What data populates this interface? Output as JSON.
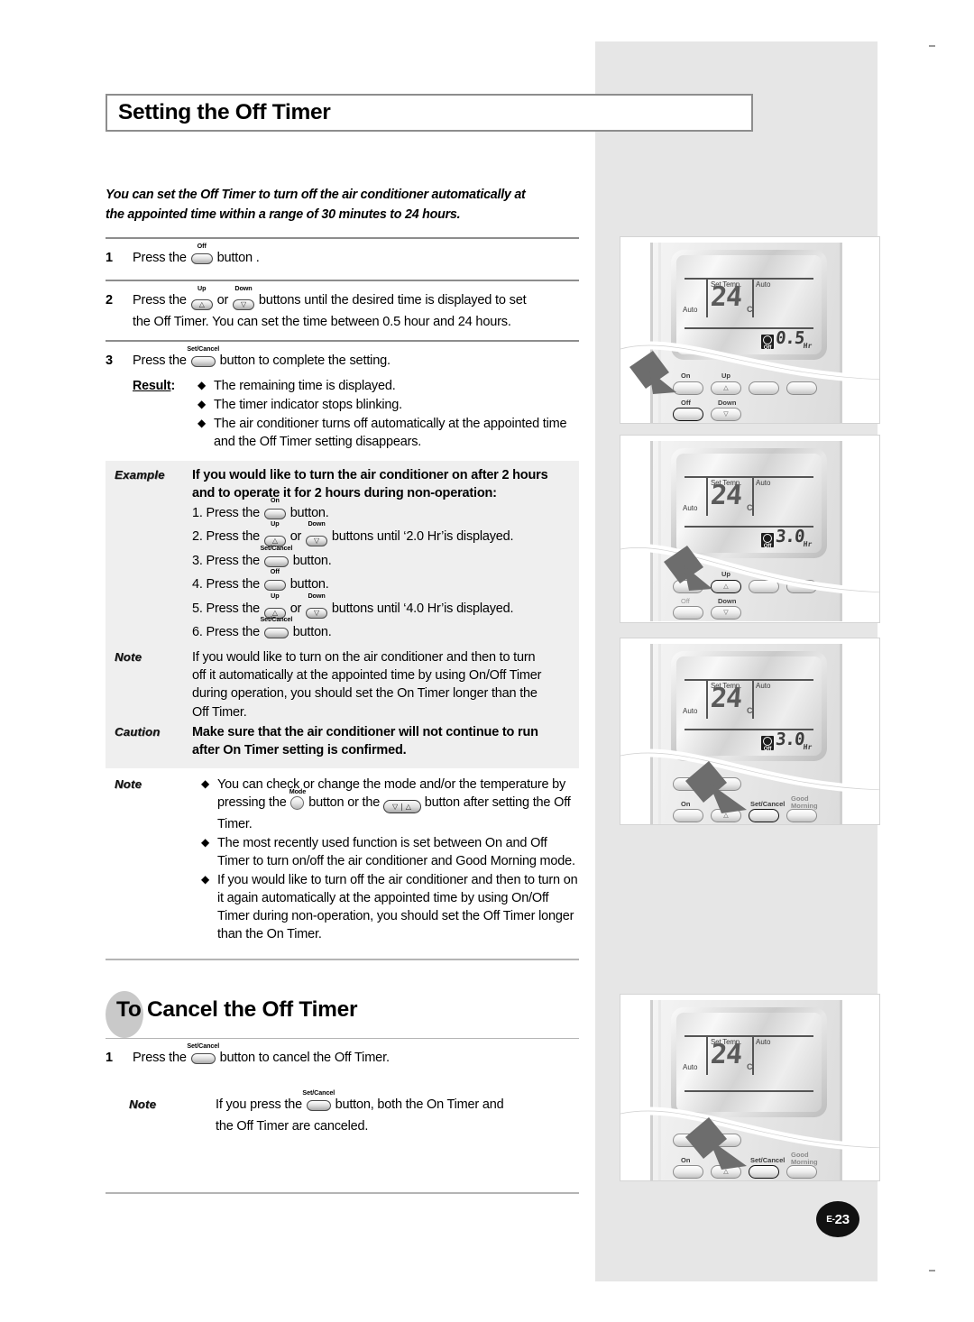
{
  "page": {
    "title": "Setting the Off Timer",
    "page_number": "E-23",
    "page_number_prefix": "E-",
    "page_number_value": "23"
  },
  "intro": {
    "line1": "You can set the Off Timer to turn off the air conditioner automatically at",
    "line2": "the appointed time within a range of 30 minutes to 24 hours."
  },
  "steps": [
    {
      "num": "1",
      "pre": "Press the",
      "button": "Off",
      "post": "button ."
    },
    {
      "num": "2",
      "pre": "Press the",
      "button_a": "Up",
      "mid": "or",
      "button_b": "Down",
      "post_line1": "buttons until the desired time is displayed to set",
      "post_line2": "the Off Timer. You can set the time between 0.5 hour and 24 hours."
    },
    {
      "num": "3",
      "pre": "Press the",
      "button": "Set/Cancel",
      "post": "button to complete the setting."
    }
  ],
  "result": {
    "label": "Result",
    "colon": ":",
    "bullets": [
      "The remaining time is displayed.",
      "The timer indicator stops blinking.",
      "The air conditioner turns off automatically at the appointed time and the Off Timer setting disappears."
    ]
  },
  "example": {
    "tag": "Example",
    "headline_line1": "If you would like to turn the air conditioner on after 2 hours",
    "headline_line2": "and to operate it for 2 hours during non-operation:",
    "lines": [
      {
        "num": "1.",
        "pre": "Press the",
        "button": "On",
        "post": "button."
      },
      {
        "num": "2.",
        "pre": "Press the",
        "button_a": "Up",
        "mid": "or",
        "button_b": "Down",
        "post": "buttons until ‘2.0 Hr’is displayed."
      },
      {
        "num": "3.",
        "pre": "Press the",
        "button": "Set/Cancel",
        "post": "button."
      },
      {
        "num": "4.",
        "pre": "Press the",
        "button": "Off",
        "post": "button."
      },
      {
        "num": "5.",
        "pre": "Press the",
        "button_a": "Up",
        "mid": "or",
        "button_b": "Down",
        "post": "buttons until ‘4.0 Hr’is displayed."
      },
      {
        "num": "6.",
        "pre": "Press the",
        "button": "Set/Cancel",
        "post": "button."
      }
    ]
  },
  "note_shaded": {
    "tag": "Note",
    "line1": "If you would like to turn on the air conditioner and then to turn",
    "line2": "off it automatically at the appointed time by using On/Off Timer",
    "line3": "during operation, you should set the On Timer longer than the",
    "line4": "Off Timer."
  },
  "caution": {
    "tag": "Caution",
    "line1": "Make sure that the air conditioner will not continue to run",
    "line2": "after On Timer setting is confirmed."
  },
  "note_bullets": {
    "tag": "Note",
    "items": [
      {
        "pre": "You can check or change the mode and/or the temperature by pressing the",
        "button_mode": "Mode",
        "mid": "button or the",
        "button_temp": "temperature-adjust",
        "post": "button after setting the Off Timer."
      },
      {
        "text": "The most recently used function is set between On and Off Timer to turn on/off the air conditioner and Good Morning mode."
      },
      {
        "text": "If you would like to turn off the air conditioner and then to turn on it again automatically at the appointed time by using On/Off Timer during non-operation, you should set the Off Timer longer than the On Timer."
      }
    ]
  },
  "cancel_section": {
    "heading_first_word": "To",
    "heading_rest": "Cancel the Off Timer",
    "step": {
      "num": "1",
      "pre": "Press the",
      "button": "Set/Cancel",
      "post": "button to cancel the Off Timer."
    },
    "note": {
      "tag": "Note",
      "pre": "If you press the",
      "button": "Set/Cancel",
      "post_line1": "button, both the On Timer and",
      "post_line2": "the Off Timer are canceled."
    }
  },
  "illustrations": [
    {
      "caption_id": "off-button-press",
      "lcd": {
        "set_temp_label": "Set Temp.",
        "auto_top": "Auto",
        "auto_left": "Auto",
        "temperature": "24",
        "unit": "C",
        "timer_indicator": "Off",
        "timer_value": "0.5",
        "timer_unit": "Hr"
      },
      "keys": [
        "On",
        "Up",
        "Off",
        "Down"
      ],
      "highlight_key": "Off"
    },
    {
      "caption_id": "up-button-press",
      "lcd": {
        "set_temp_label": "Set Temp.",
        "auto_top": "Auto",
        "auto_left": "Auto",
        "temperature": "24",
        "unit": "C",
        "timer_indicator": "Off",
        "timer_value": "3.0",
        "timer_unit": "Hr"
      },
      "keys": [
        "Off",
        "Up",
        "Off",
        "Down"
      ],
      "highlight_key": "Up"
    },
    {
      "caption_id": "set-cancel-button-press",
      "lcd": {
        "set_temp_label": "Set Temp.",
        "auto_top": "Auto",
        "auto_left": "Auto",
        "temperature": "24",
        "unit": "C",
        "timer_indicator": "Off",
        "timer_value": "3.0",
        "timer_unit": "Hr"
      },
      "keys": [
        "On",
        "Set/Cancel",
        "Good Morning"
      ],
      "highlight_key": "Set/Cancel"
    },
    {
      "caption_id": "cancel-off-timer",
      "lcd": {
        "set_temp_label": "Set Temp.",
        "auto_top": "Auto",
        "auto_left": "Auto",
        "temperature": "24",
        "unit": "C",
        "timer_indicator": "",
        "timer_value": "",
        "timer_unit": ""
      },
      "keys": [
        "On",
        "Set/Cancel",
        "Good Morning"
      ],
      "highlight_key": "Set/Cancel"
    }
  ],
  "glyphs": {
    "diamond": "◆",
    "up_arrow": "△",
    "down_arrow": "▽"
  }
}
